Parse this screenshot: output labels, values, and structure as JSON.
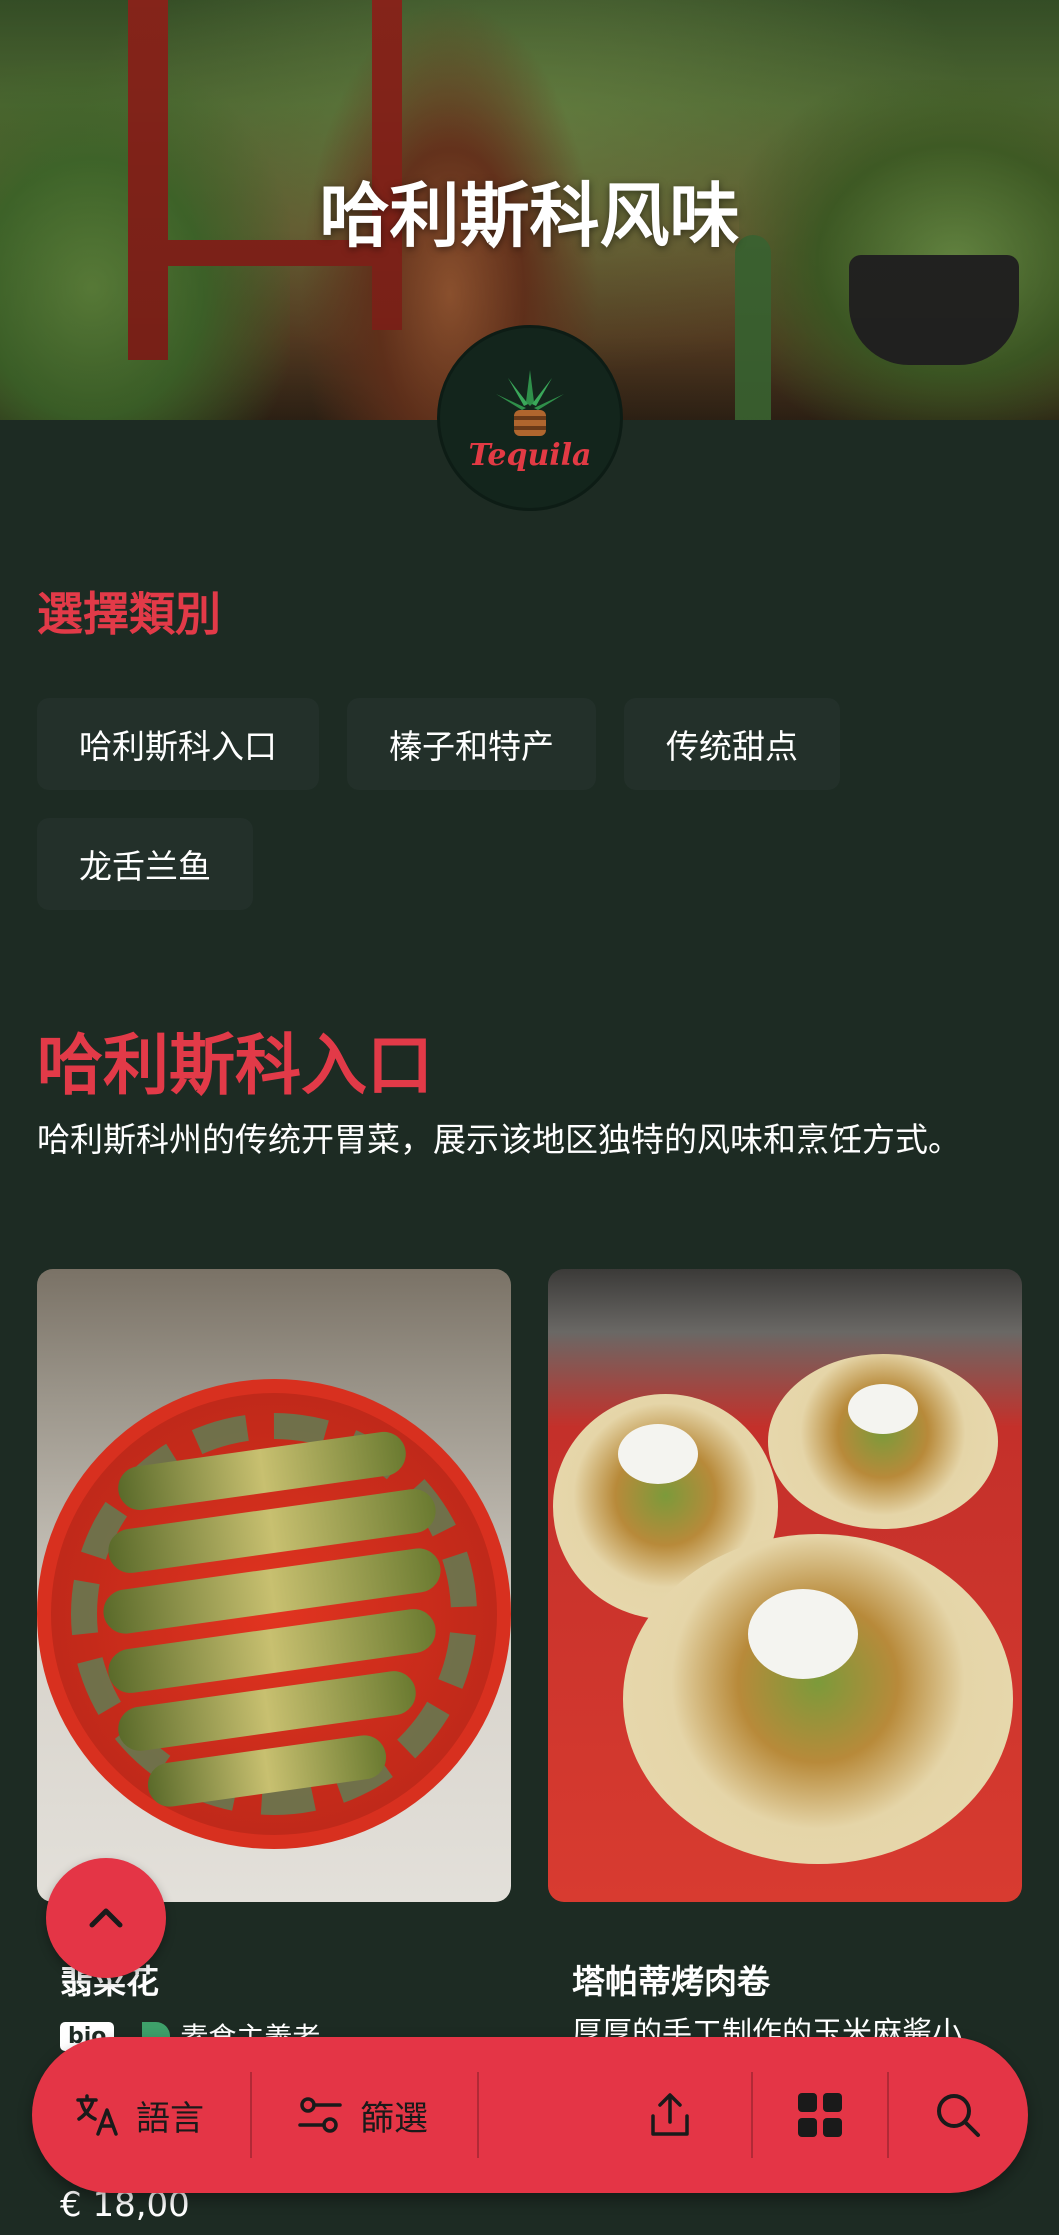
{
  "hero": {
    "title": "哈利斯科风味",
    "logo_text": "Tequila"
  },
  "categories": {
    "heading": "選擇類別",
    "chips": [
      "哈利斯科入口",
      "榛子和特产",
      "传统甜点",
      "龙舌兰鱼"
    ]
  },
  "section": {
    "title": "哈利斯科入口",
    "description": "哈利斯科州的传统开胃菜，展示该地区独特的风味和烹饪方式。"
  },
  "items": [
    {
      "name": "翡菜花",
      "tags": {
        "bio": "bio",
        "vegetarian": "素食主義者"
      },
      "price": "€ 18,00"
    },
    {
      "name": "塔帕蒂烤肉卷",
      "description": "厚厚的手工制作的玉米麻酱小"
    }
  ],
  "bottom_bar": {
    "language_label": "語言",
    "filter_label": "篩選"
  },
  "colors": {
    "accent": "#e43546",
    "background": "#1d2b23",
    "chip": "#23302a"
  },
  "icons": [
    "translate-icon",
    "filter-icon",
    "share-icon",
    "grid-icon",
    "search-icon",
    "chevron-up-icon"
  ]
}
